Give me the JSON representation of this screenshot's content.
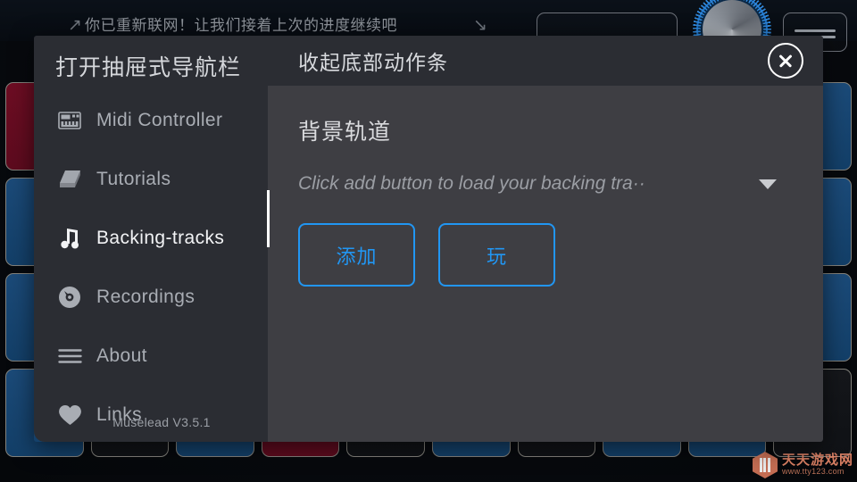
{
  "background": {
    "banner_text": "你已重新联网！让我们接着上次的进度继续吧",
    "arrow_left": "↗",
    "arrow_right": "↘",
    "pads": [
      [
        "red",
        "blue",
        "blue",
        "blue",
        "blue",
        "blue",
        "dark",
        "blue",
        "blue",
        "blue"
      ],
      [
        "blue",
        "blue",
        "blue",
        "dark",
        "blue",
        "blue",
        "blue",
        "blue",
        "dark",
        "blue"
      ],
      [
        "blue",
        "blue",
        "red",
        "dark",
        "blue",
        "blue",
        "blue",
        "dark",
        "blue",
        "blue"
      ],
      [
        "blue",
        "dark",
        "blue",
        "red",
        "dark",
        "blue",
        "dark",
        "blue",
        "blue",
        "dark"
      ]
    ],
    "watermark": {
      "name": "天天游戏网",
      "url": "www.tty123.com"
    }
  },
  "drawer": {
    "title": "打开抽屉式导航栏",
    "version": "Muselead V3.5.1",
    "items": [
      {
        "label": "Midi Controller",
        "icon": "keyboard-icon",
        "active": false
      },
      {
        "label": "Tutorials",
        "icon": "book-icon",
        "active": false
      },
      {
        "label": "Backing-tracks",
        "icon": "music-note-icon",
        "active": true
      },
      {
        "label": "Recordings",
        "icon": "disc-icon",
        "active": false
      },
      {
        "label": "About",
        "icon": "hamburger-icon",
        "active": false
      },
      {
        "label": "Links",
        "icon": "heart-icon",
        "active": false
      }
    ]
  },
  "panel": {
    "header_title": "收起底部动作条",
    "close_label": "close-icon",
    "section_title": "背景轨道",
    "select_value": "Click add button to load your backing tra··",
    "buttons": [
      {
        "label": "添加"
      },
      {
        "label": "玩"
      }
    ]
  },
  "colors": {
    "accent": "#2196f3",
    "drawer_bg": "#2b2d33",
    "panel_bg": "#3e3e43",
    "pad_blue": "#1b4a78",
    "pad_red": "#6d0d23"
  }
}
